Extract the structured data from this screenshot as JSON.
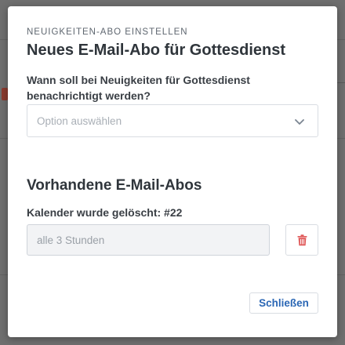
{
  "modal": {
    "eyebrow": "NEUIGKEITEN-ABO EINSTELLEN",
    "title": "Neues E-Mail-Abo für Gottesdienst",
    "question": "Wann soll bei Neuigkeiten für Gottesdienst benachrichtigt werden?",
    "select": {
      "placeholder": "Option auswählen",
      "icon": "chevron-down-icon"
    },
    "existing": {
      "title": "Vorhandene E-Mail-Abos",
      "subscriptions": [
        {
          "label": "Kalender wurde gelöscht: #22",
          "frequency": "alle 3 Stunden",
          "delete_icon": "trash-icon"
        }
      ]
    },
    "close_label": "Schließen"
  },
  "colors": {
    "accent": "#2b67b5",
    "danger": "#e05a5a",
    "overlay": "#6f6f6f"
  }
}
